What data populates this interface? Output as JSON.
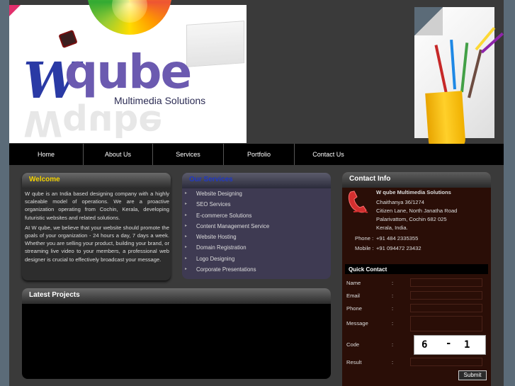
{
  "header": {
    "logo_w": "W",
    "logo_brand": "qube",
    "logo_tagline": "Multimedia Solutions"
  },
  "nav": {
    "items": [
      {
        "label": "Home"
      },
      {
        "label": "About Us"
      },
      {
        "label": "Services"
      },
      {
        "label": "Portfolio"
      },
      {
        "label": "Contact Us"
      }
    ]
  },
  "welcome": {
    "title": "Welcome",
    "para1": "W qube is an India based designing company with a highly scaleable model of operations. We are a proactive organization operating from Cochin, Kerala, developing futuristic websites and related solutions.",
    "para2": "At W qube, we believe that your website should promote the goals of your organization - 24 hours a day, 7 days a week. Whether you are selling your product, building your brand, or streaming live video to your members, a professional web designer is crucial to effectively broadcast your message."
  },
  "services": {
    "title": "Our Services",
    "items": [
      "Website Designing",
      "SEO Services",
      "E-commerce Solutions",
      "Content Management Service",
      "Website Hosting",
      "Domain Registration",
      "Logo Designing",
      "Corporate Presentations"
    ]
  },
  "projects": {
    "title": "Latest Projects"
  },
  "contact": {
    "title": "Contact Info",
    "company": "W qube Multimedia Solutions",
    "address1": "Chaithanya 36/1274",
    "address2": "Citizen Lane, North Janatha Road",
    "address3": "Palarivattom, Cochin 682 025",
    "address4": "Kerala, India.",
    "phone_label": "Phone :",
    "phone": "+91 484 2335355",
    "mobile_label": "Mobile :",
    "mobile": "+91 094472 23432"
  },
  "quick_contact": {
    "title": "Quick Contact",
    "name_label": "Name",
    "email_label": "Email",
    "phone_label": "Phone",
    "message_label": "Message",
    "code_label": "Code",
    "result_label": "Result",
    "colon": ":",
    "captcha_a": "6",
    "captcha_op": "-",
    "captcha_b": "1",
    "submit_label": "Submit"
  },
  "colors": {
    "background": "#5b6b78",
    "welcome_title": "#f3d200",
    "services_title": "#1f38c5",
    "contact_bg": "#2a0e07"
  }
}
